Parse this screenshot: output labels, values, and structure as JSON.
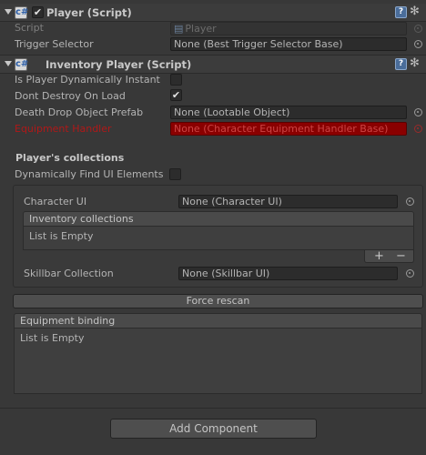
{
  "player_component": {
    "title": "Player (Script)",
    "script_label": "Script",
    "script_value": "Player",
    "trigger_selector_label": "Trigger Selector",
    "trigger_selector_value": "None (Best Trigger Selector Base)"
  },
  "inventory_component": {
    "title": "Inventory Player (Script)",
    "fields": {
      "is_player_dynamically_instant": "Is Player Dynamically Instant",
      "dont_destroy_on_load": "Dont Destroy On Load",
      "death_drop_label": "Death Drop Object Prefab",
      "death_drop_value": "None (Lootable Object)",
      "equipment_handler_label": "Equipment Handler",
      "equipment_handler_value": "None (Character Equipment Handler Base)"
    },
    "toggles": {
      "is_player_dynamically_instant": false,
      "dont_destroy_on_load": true,
      "dynamically_find_ui": false
    },
    "collections_title": "Player's collections",
    "dynamically_find_ui_label": "Dynamically Find UI Elements",
    "character_ui_label": "Character UI",
    "character_ui_value": "None (Character UI)",
    "inventory_collections_header": "Inventory collections",
    "inventory_collections_empty": "List is Empty",
    "list_add": "+",
    "list_remove": "−",
    "skillbar_label": "Skillbar Collection",
    "skillbar_value": "None (Skillbar UI)",
    "force_rescan_label": "Force rescan",
    "equipment_binding_header": "Equipment binding",
    "equipment_binding_empty": "List is Empty"
  },
  "add_component_label": "Add Component",
  "glyphs": {
    "script_icon": "c#",
    "script_file_icon": "▤",
    "check": "✔",
    "help": "?",
    "gear": "✻"
  }
}
